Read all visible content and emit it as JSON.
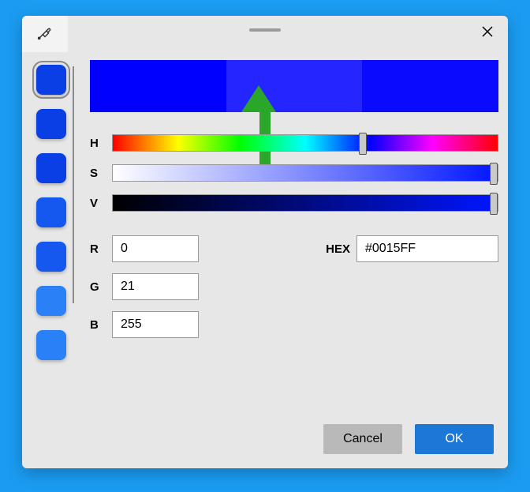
{
  "swatches": [
    {
      "color": "#0a3fe6",
      "selected": true
    },
    {
      "color": "#0a3fe6",
      "selected": false
    },
    {
      "color": "#0a3fe6",
      "selected": false
    },
    {
      "color": "#1458f0",
      "selected": false
    },
    {
      "color": "#1458f0",
      "selected": false
    },
    {
      "color": "#2a80f7",
      "selected": false
    },
    {
      "color": "#2a80f7",
      "selected": false
    }
  ],
  "sliders": {
    "h": {
      "label": "H",
      "thumb_pct": 65
    },
    "s": {
      "label": "S",
      "thumb_pct": 99
    },
    "v": {
      "label": "V",
      "thumb_pct": 99
    }
  },
  "rgb": {
    "r_label": "R",
    "r_value": "0",
    "g_label": "G",
    "g_value": "21",
    "b_label": "B",
    "b_value": "255"
  },
  "hex": {
    "label": "HEX",
    "value": "#0015FF"
  },
  "buttons": {
    "cancel": "Cancel",
    "ok": "OK"
  }
}
